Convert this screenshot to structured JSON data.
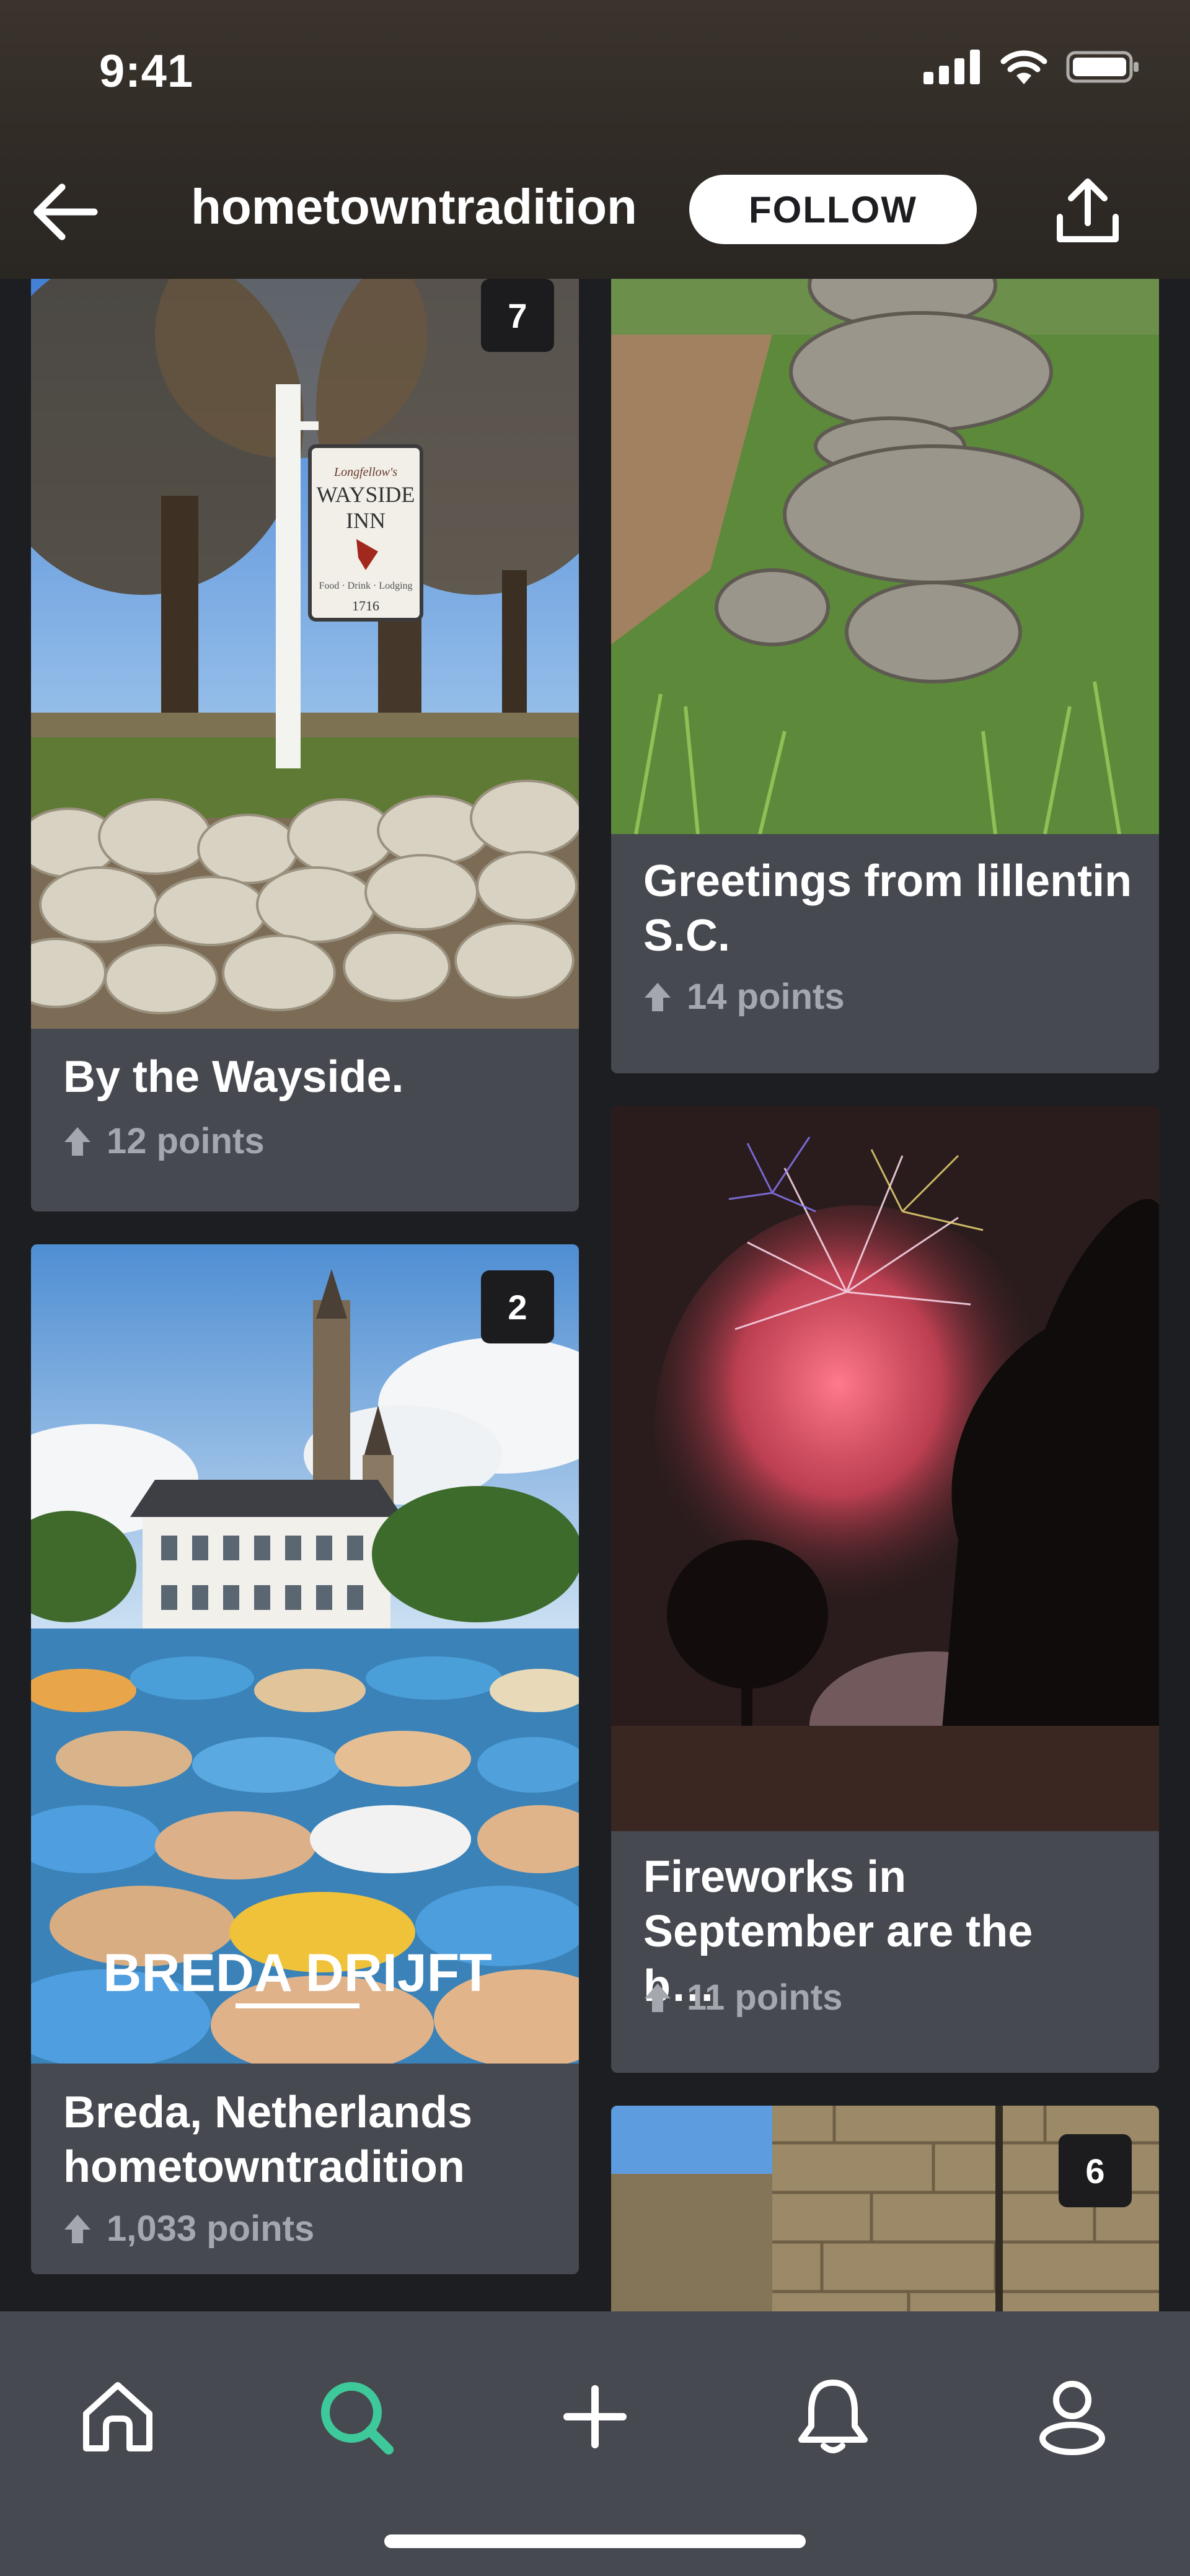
{
  "status_bar": {
    "time": "9:41"
  },
  "header": {
    "title": "hometowntradition",
    "follow_label": "FOLLOW"
  },
  "posts": [
    {
      "title": "By the Wayside.",
      "points": "12 points",
      "badge": "7"
    },
    {
      "title": "Greetings from lillentin S.C.",
      "points": "14 points",
      "badge": ""
    },
    {
      "title": "Breda, Netherlands hometowntradition",
      "points": "1,033 points",
      "badge": "2"
    },
    {
      "title": "Fireworks in September are the b…",
      "points": "11 points",
      "badge": ""
    },
    {
      "title": "",
      "points": "",
      "badge": "6"
    }
  ],
  "wayside_sign": {
    "line1": "Longfellow's",
    "line2": "WAYSIDE",
    "line3": "INN",
    "line4": "Food · Drink · Lodging",
    "year": "1716"
  },
  "breda_banner": "BREDA DRIJFT",
  "tabs": [
    "home-icon",
    "search-icon",
    "add-icon",
    "notifications-icon",
    "profile-icon"
  ],
  "colors": {
    "accent": "#3ec99a",
    "card_bg": "#464950",
    "page_bg": "#1d1e21",
    "muted_text": "#a4a7ae"
  }
}
